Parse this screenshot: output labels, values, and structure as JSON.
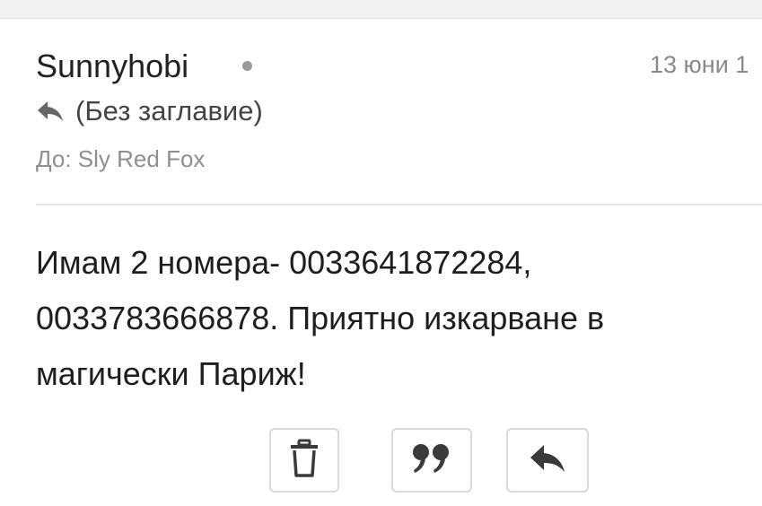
{
  "email": {
    "sender": "Sunnyhobi",
    "date": "13 юни 1",
    "subject": "(Без заглавие)",
    "to_line": "До: Sly Red Fox",
    "body_lines": [
      "Имам 2 номера- 0033641872284,",
      "0033783666878. Приятно изкарване в",
      "магически Париж!"
    ]
  },
  "actions": {
    "delete_icon": "trash-icon",
    "quote_icon": "quote-icon",
    "reply_icon": "reply-icon"
  },
  "colors": {
    "icon": "#3a3a3a",
    "muted_text": "#8a8a8a",
    "border": "#d9d9d9"
  }
}
